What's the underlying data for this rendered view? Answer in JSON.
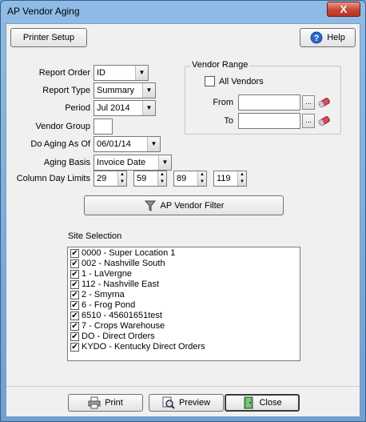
{
  "window": {
    "title": "AP Vendor Aging",
    "close_glyph": "X"
  },
  "toolbar": {
    "printer_setup": "Printer Setup",
    "help": "Help"
  },
  "form": {
    "report_order": {
      "label": "Report Order",
      "value": "ID"
    },
    "report_type": {
      "label": "Report Type",
      "value": "Summary"
    },
    "period": {
      "label": "Period",
      "value": "Jul 2014"
    },
    "vendor_group": {
      "label": "Vendor Group",
      "value": ""
    },
    "do_aging_as_of": {
      "label": "Do Aging As Of",
      "value": "06/01/14"
    },
    "aging_basis": {
      "label": "Aging Basis",
      "value": "Invoice Date"
    },
    "column_day_limits": {
      "label": "Column Day Limits",
      "values": [
        "29",
        "59",
        "89",
        "119"
      ]
    }
  },
  "vendor_range": {
    "title": "Vendor Range",
    "all_vendors_label": "All Vendors",
    "all_vendors_checked": false,
    "from_label": "From",
    "from_value": "",
    "to_label": "To",
    "to_value": "",
    "ellipsis": "..."
  },
  "filter_button": "AP Vendor Filter",
  "site_selection": {
    "label": "Site Selection",
    "items": [
      {
        "label": "0000 - Super Location 1",
        "checked": true
      },
      {
        "label": "002 - Nashville South",
        "checked": true
      },
      {
        "label": "1 - LaVergne",
        "checked": true
      },
      {
        "label": "112 - Nashville East",
        "checked": true
      },
      {
        "label": "2 - Smyrna",
        "checked": true
      },
      {
        "label": "6 - Frog Pond",
        "checked": true
      },
      {
        "label": "6510 - 45601651test",
        "checked": true
      },
      {
        "label": "7 - Crops Warehouse",
        "checked": true
      },
      {
        "label": "DO - Direct Orders",
        "checked": true
      },
      {
        "label": "KYDO - Kentucky Direct Orders",
        "checked": true
      }
    ]
  },
  "bottom": {
    "print": "Print",
    "preview": "Preview",
    "close": "Close"
  },
  "glyphs": {
    "check": "✔",
    "dropdown": "▼",
    "spin_up": "▲",
    "spin_down": "▼"
  },
  "icons": {
    "help": "help-icon",
    "filter": "funnel-icon",
    "print": "printer-icon",
    "preview": "magnifier-icon",
    "close": "door-icon",
    "eraser": "eraser-icon"
  }
}
